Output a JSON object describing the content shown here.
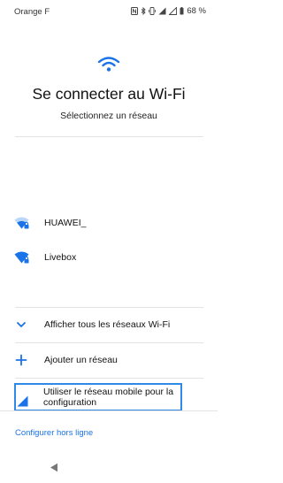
{
  "status_bar": {
    "carrier": "Orange F",
    "battery_percent": "68 %"
  },
  "header": {
    "title": "Se connecter au Wi-Fi",
    "subtitle": "Sélectionnez un réseau"
  },
  "networks": [
    {
      "name": "HUAWEI_",
      "secured": true
    },
    {
      "name": "Livebox",
      "secured": true
    }
  ],
  "options": {
    "show_all": "Afficher tous les réseaux Wi-Fi",
    "add_network": "Ajouter un réseau",
    "use_mobile": "Utiliser le réseau mobile pour la configuration"
  },
  "footer": {
    "offline_link": "Configurer hors ligne"
  },
  "colors": {
    "accent": "#1a73e8",
    "focus_border": "#2e8ae6"
  }
}
